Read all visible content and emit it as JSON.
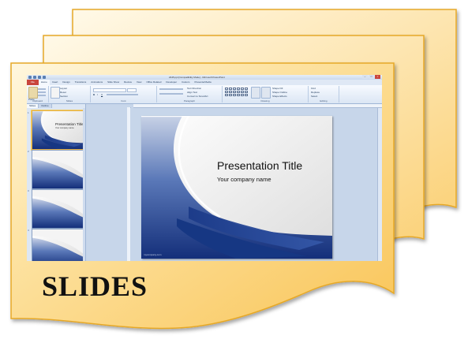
{
  "caption": "SLIDES",
  "window": {
    "title": "2445.ppt [Compatibility Mode] - Microsoft PowerPoint",
    "tabs": [
      "File",
      "Home",
      "Insert",
      "Design",
      "Transitions",
      "Animations",
      "Slide Show",
      "Review",
      "View",
      "Office Related",
      "Developer",
      "Custom",
      "PresenterMedia"
    ],
    "controls": [
      "−",
      "□",
      "×"
    ]
  },
  "ribbon": {
    "groups": [
      "Clipboard",
      "Slides",
      "Font",
      "Paragraph",
      "Drawing",
      "Editing"
    ],
    "paste_label": "Paste",
    "new_slide_label": "New Slide",
    "layout_label": "Layout",
    "reset_label": "Reset",
    "section_label": "Section",
    "text_direction_label": "Text Direction",
    "align_text_label": "Align Text",
    "convert_smartart_label": "Convert to SmartArt",
    "arrange_label": "Arrange",
    "quick_styles_label": "Quick Styles",
    "shape_fill_label": "Shape Fill",
    "shape_outline_label": "Shape Outline",
    "shape_effects_label": "Shape Effects",
    "find_label": "Find",
    "replace_label": "Replace",
    "select_label": "Select"
  },
  "panel": {
    "tabs": [
      "Slides",
      "Outline"
    ],
    "thumbnails": [
      {
        "number": "1",
        "title": "Presentation Title",
        "subtitle": "Your company name"
      },
      {
        "number": "2"
      },
      {
        "number": "3"
      },
      {
        "number": "4"
      }
    ]
  },
  "slide": {
    "title": "Presentation Title",
    "subtitle": "Your company name",
    "footer": "mycompany.com"
  },
  "colors": {
    "page_fill": "#fbd88a",
    "page_border": "#e6a828",
    "slide_blue": "#1f3f8c",
    "file_tab": "#c9463d"
  }
}
